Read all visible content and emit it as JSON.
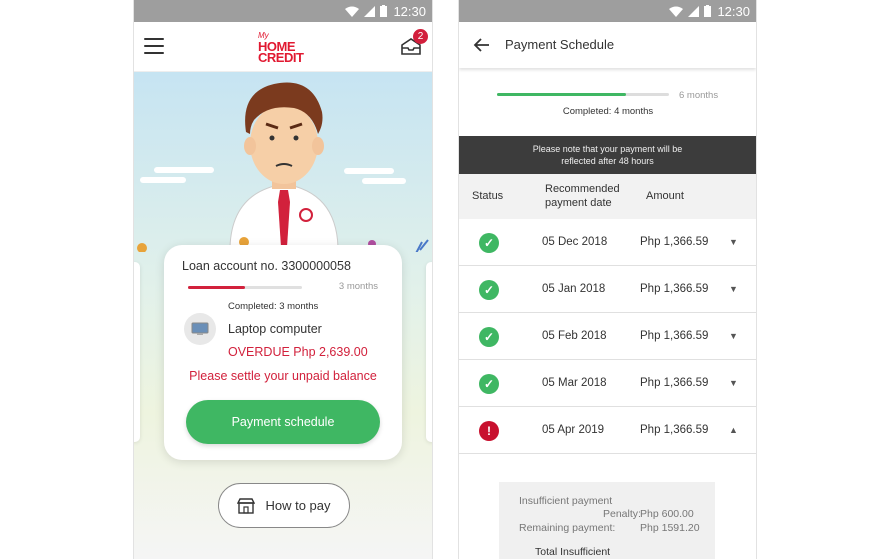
{
  "status_bar": {
    "time": "12:30"
  },
  "phone1": {
    "logo": {
      "my": "My",
      "line1": "HOME",
      "line2": "CREDIT"
    },
    "inbox_badge": "2",
    "card": {
      "account_label": "Loan account no. 3300000058",
      "progress_fraction": 0.5,
      "progress_total": "3 months",
      "completed_text": "Completed: 3 months",
      "product_name": "Laptop computer",
      "overdue_text": "OVERDUE Php 2,639.00",
      "settle_text": "Please settle your unpaid balance",
      "payment_schedule_button": "Payment schedule"
    },
    "how_to_pay_button": "How to pay"
  },
  "phone2": {
    "title": "Payment Schedule",
    "progress_fraction": 0.75,
    "progress_total": "6 months",
    "completed_text": "Completed: 4 months",
    "notice_line1": "Please note that your payment will be",
    "notice_line2": "reflected after 48 hours",
    "table_headers": {
      "status": "Status",
      "date_line1": "Recommended",
      "date_line2": "payment date",
      "amount": "Amount"
    },
    "rows": [
      {
        "status": "paid",
        "date": "05 Dec 2018",
        "amount": "Php 1,366.59",
        "expanded": false
      },
      {
        "status": "paid",
        "date": "05 Jan 2018",
        "amount": "Php 1,366.59",
        "expanded": false
      },
      {
        "status": "paid",
        "date": "05 Feb 2018",
        "amount": "Php 1,366.59",
        "expanded": false
      },
      {
        "status": "paid",
        "date": "05 Mar 2018",
        "amount": "Php 1,366.59",
        "expanded": false
      },
      {
        "status": "overdue",
        "date": "05 Apr 2019",
        "amount": "Php 1,366.59",
        "expanded": true
      }
    ],
    "details": {
      "insufficient_label": "Insufficient payment",
      "penalty_label": "Penalty:",
      "penalty_value": "Php 600.00",
      "remaining_label": "Remaining payment:",
      "remaining_value": "Php 1591.20",
      "total_label": "Total Insufficient"
    }
  },
  "colors": {
    "brand_red": "#e11931",
    "success_green": "#3fb763",
    "notice_bg": "#3c3c3c"
  }
}
